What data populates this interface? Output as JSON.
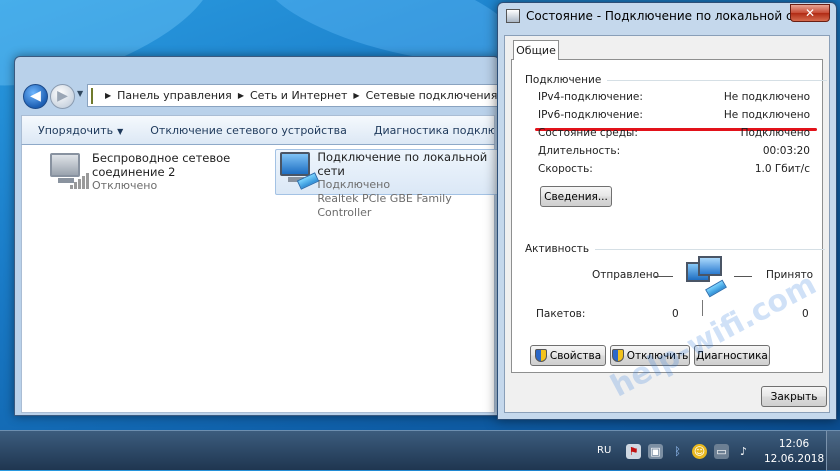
{
  "explorer": {
    "breadcrumb": [
      "Панель управления",
      "Сеть и Интернет",
      "Сетевые подключения"
    ],
    "toolbar": {
      "organize": "Упорядочить",
      "disable": "Отключение сетевого устройства",
      "diagnose": "Диагностика подключения"
    },
    "connections": [
      {
        "name_line1": "Беспроводное сетевое",
        "name_line2": "соединение 2",
        "status": "Отключено",
        "icon": "wireless-network-icon"
      },
      {
        "name": "Подключение по локальной сети",
        "status": "Подключено",
        "adapter": "Realtek PCIe GBE Family Controller",
        "icon": "lan-network-icon"
      }
    ]
  },
  "dialog": {
    "title": "Состояние - Подключение по локальной сети",
    "close": "✕",
    "tab": "Общие",
    "connection_section": "Подключение",
    "rows": [
      {
        "label": "IPv4-подключение:",
        "value": "Не подключено"
      },
      {
        "label": "IPv6-подключение:",
        "value": "Не подключено"
      },
      {
        "label": "Состояние среды:",
        "value": "Подключено"
      },
      {
        "label": "Длительность:",
        "value": "00:03:20"
      },
      {
        "label": "Скорость:",
        "value": "1.0 Гбит/с"
      }
    ],
    "details_button": "Сведения...",
    "activity_section": "Активность",
    "sent_label": "Отправлено",
    "received_label": "Принято",
    "packets_label": "Пакетов:",
    "packets_sent": "0",
    "packets_received": "0",
    "properties_button": "Свойства",
    "disable_button": "Отключить",
    "diagnose_button": "Диагностика",
    "close_button": "Закрыть",
    "accent_color": "#e2121a"
  },
  "taskbar": {
    "language": "RU",
    "time": "12:06",
    "date": "12.06.2018"
  },
  "watermark": "help-wifi.com"
}
